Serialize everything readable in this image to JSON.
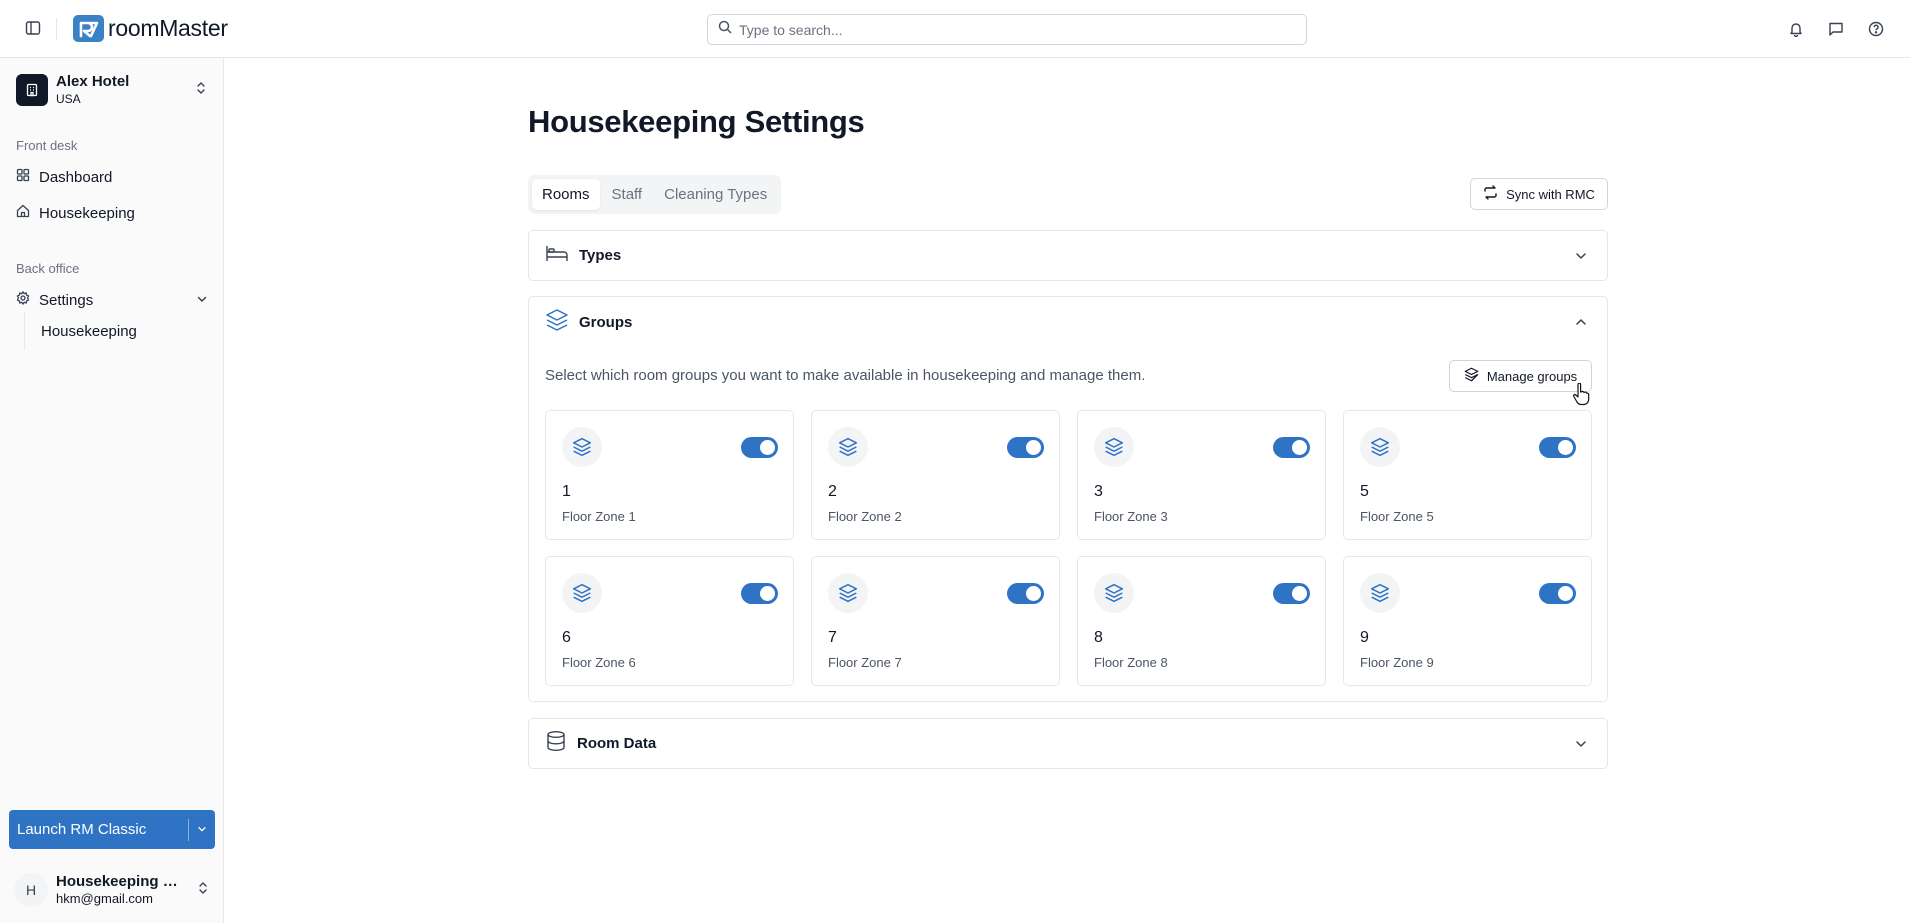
{
  "app": {
    "brand": "roomMaster",
    "search_placeholder": "Type to search..."
  },
  "sidebar": {
    "hotel": {
      "name": "Alex Hotel",
      "country": "USA"
    },
    "sections": [
      {
        "label": "Front desk",
        "items": [
          {
            "label": "Dashboard",
            "icon": "dashboard-icon"
          },
          {
            "label": "Housekeeping",
            "icon": "home-icon"
          }
        ]
      },
      {
        "label": "Back office",
        "items": [
          {
            "label": "Settings",
            "icon": "gear-icon",
            "expanded": true
          }
        ],
        "sub_items": [
          {
            "label": "Housekeeping"
          }
        ]
      }
    ],
    "launch_label": "Launch RM Classic",
    "user": {
      "initial": "H",
      "name": "Housekeeping Manager",
      "email": "hkm@gmail.com"
    }
  },
  "main": {
    "title": "Housekeeping Settings",
    "tabs": [
      {
        "label": "Rooms",
        "active": true
      },
      {
        "label": "Staff",
        "active": false
      },
      {
        "label": "Cleaning Types",
        "active": false
      }
    ],
    "sync_label": "Sync with RMC",
    "panels": {
      "types": {
        "title": "Types",
        "expanded": false
      },
      "groups": {
        "title": "Groups",
        "expanded": true,
        "description": "Select which room groups you want to make available in housekeeping and manage them.",
        "manage_label": "Manage groups",
        "items": [
          {
            "number": "1",
            "name": "Floor Zone 1",
            "enabled": true
          },
          {
            "number": "2",
            "name": "Floor Zone 2",
            "enabled": true
          },
          {
            "number": "3",
            "name": "Floor Zone 3",
            "enabled": true
          },
          {
            "number": "5",
            "name": "Floor Zone 5",
            "enabled": true
          },
          {
            "number": "6",
            "name": "Floor Zone 6",
            "enabled": true
          },
          {
            "number": "7",
            "name": "Floor Zone 7",
            "enabled": true
          },
          {
            "number": "8",
            "name": "Floor Zone 8",
            "enabled": true
          },
          {
            "number": "9",
            "name": "Floor Zone 9",
            "enabled": true
          }
        ]
      },
      "room_data": {
        "title": "Room Data",
        "expanded": false
      }
    }
  },
  "colors": {
    "accent": "#2f73c4",
    "brand": "#3b82c4"
  }
}
